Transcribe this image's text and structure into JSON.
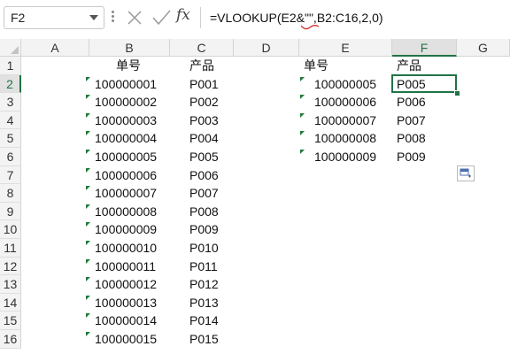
{
  "formula_bar": {
    "name_box": "F2",
    "fx_label": "fx",
    "formula": "=VLOOKUP(E2&\"\",B2:C16,2,0)"
  },
  "columns": [
    "A",
    "B",
    "C",
    "D",
    "E",
    "F",
    "G"
  ],
  "rows": [
    "1",
    "2",
    "3",
    "4",
    "5",
    "6",
    "7",
    "8",
    "9",
    "10",
    "11",
    "12",
    "13",
    "14",
    "15",
    "16"
  ],
  "selected_cell": "F2",
  "table_left": {
    "header_order": "单号",
    "header_product": "产品",
    "rows": [
      {
        "order": "100000001",
        "product": "P001"
      },
      {
        "order": "100000002",
        "product": "P002"
      },
      {
        "order": "100000003",
        "product": "P003"
      },
      {
        "order": "100000004",
        "product": "P004"
      },
      {
        "order": "100000005",
        "product": "P005"
      },
      {
        "order": "100000006",
        "product": "P006"
      },
      {
        "order": "100000007",
        "product": "P007"
      },
      {
        "order": "100000008",
        "product": "P008"
      },
      {
        "order": "100000009",
        "product": "P009"
      },
      {
        "order": "100000010",
        "product": "P010"
      },
      {
        "order": "100000011",
        "product": "P011"
      },
      {
        "order": "100000012",
        "product": "P012"
      },
      {
        "order": "100000013",
        "product": "P013"
      },
      {
        "order": "100000014",
        "product": "P014"
      },
      {
        "order": "100000015",
        "product": "P015"
      }
    ]
  },
  "table_right": {
    "header_order": "单号",
    "header_product": "产品",
    "rows": [
      {
        "order": "100000005",
        "product": "P005"
      },
      {
        "order": "100000006",
        "product": "P006"
      },
      {
        "order": "100000007",
        "product": "P007"
      },
      {
        "order": "100000008",
        "product": "P008"
      },
      {
        "order": "100000009",
        "product": "P009"
      }
    ]
  },
  "colors": {
    "accent": "#217346",
    "error_triangle": "#1f7a3a",
    "squiggle": "#d32f2f"
  }
}
